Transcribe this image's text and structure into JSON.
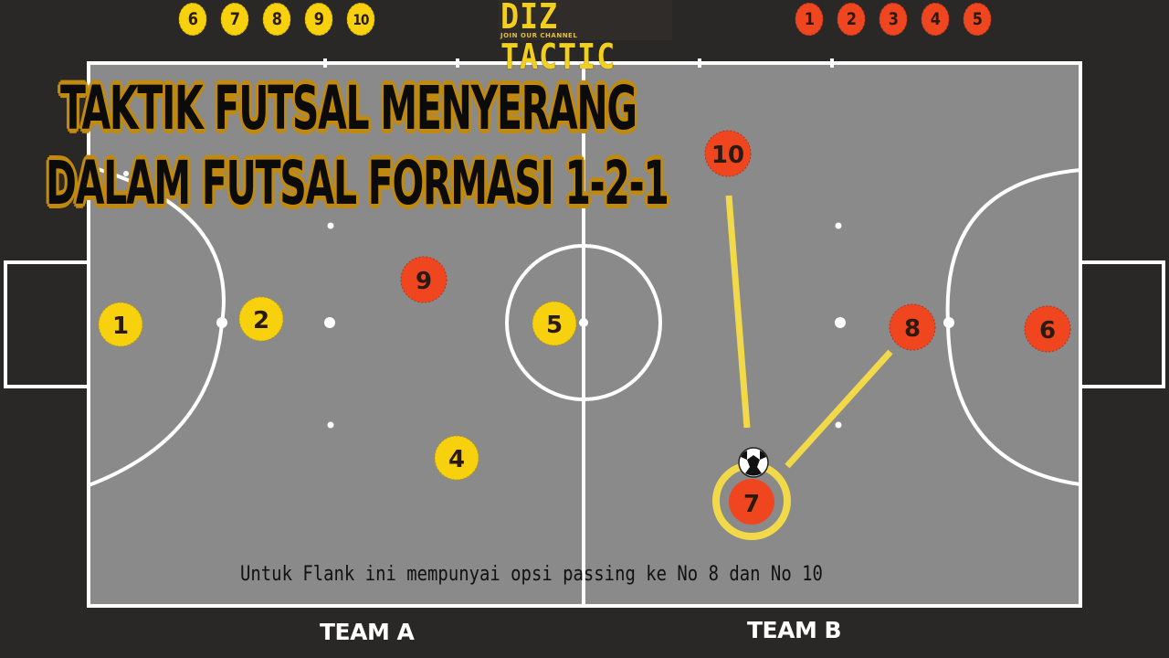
{
  "logo": {
    "name": "DIZ TACTIC",
    "tagline": "JOIN OUR CHANNEL",
    "color": "#f2cf1c"
  },
  "legend": {
    "team_a_numbers": [
      "6",
      "7",
      "8",
      "9",
      "10"
    ],
    "team_b_numbers": [
      "1",
      "2",
      "3",
      "4",
      "5"
    ]
  },
  "title": {
    "line1": "TAKTIK FUTSAL MENYERANG",
    "line2": "DALAM FUTSAL FORMASI 1-2-1"
  },
  "caption": "Untuk Flank ini mempunyai opsi passing ke No 8 dan No 10",
  "teams": {
    "team_a": {
      "label": "TEAM A",
      "color": "#f7d10e"
    },
    "team_b": {
      "label": "TEAM B",
      "color": "#f0461f"
    }
  },
  "colors": {
    "background": "#2a2827",
    "pitch": "#8a8a8a",
    "lines": "#ffffff",
    "pass_line": "#f2d94a",
    "title_outline": "#c08a10"
  },
  "players": [
    {
      "id": "a1",
      "team": "team_a",
      "number": "1",
      "role": "goalkeeper"
    },
    {
      "id": "a2",
      "team": "team_a",
      "number": "2"
    },
    {
      "id": "a4",
      "team": "team_a",
      "number": "4"
    },
    {
      "id": "a5",
      "team": "team_a",
      "number": "5"
    },
    {
      "id": "b9",
      "team": "team_b",
      "number": "9"
    },
    {
      "id": "b10",
      "team": "team_b",
      "number": "10"
    },
    {
      "id": "b8",
      "team": "team_b",
      "number": "8"
    },
    {
      "id": "b6",
      "team": "team_b",
      "number": "6",
      "role": "goalkeeper"
    },
    {
      "id": "b7",
      "team": "team_b",
      "number": "7",
      "has_ball": true,
      "highlighted": true
    }
  ],
  "passing_options": [
    {
      "from": "7",
      "to": "10"
    },
    {
      "from": "7",
      "to": "8"
    }
  ]
}
